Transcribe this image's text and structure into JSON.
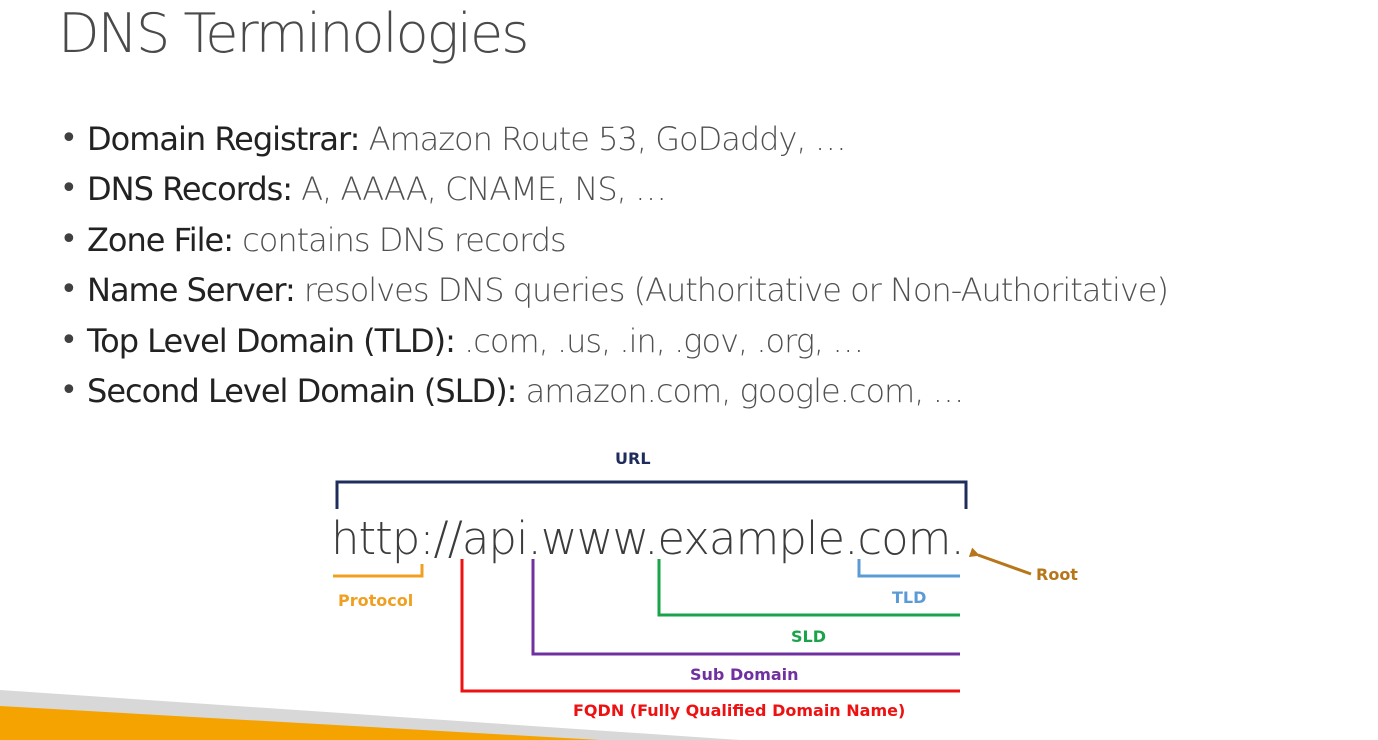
{
  "slide": {
    "title": "DNS Terminologies"
  },
  "bullets": [
    {
      "term": "Domain Registrar:",
      "desc": " Amazon Route 53, GoDaddy, …"
    },
    {
      "term": "DNS Records:",
      "desc": " A, AAAA, CNAME, NS, …"
    },
    {
      "term": "Zone File:",
      "desc": " contains DNS records"
    },
    {
      "term": "Name Server:",
      "desc": " resolves DNS queries (Authoritative or Non-Authoritative)"
    },
    {
      "term": "Top Level Domain (TLD):",
      "desc": " .com, .us, .in, .gov, .org, …"
    },
    {
      "term": "Second Level Domain (SLD):",
      "desc": " amazon.com, google.com, …"
    }
  ],
  "bullet_symbol": "•",
  "diagram": {
    "url_text": "http://api.www.example.com.",
    "labels": {
      "url": "URL",
      "protocol": "Protocol",
      "tld": "TLD",
      "root": "Root",
      "sld": "SLD",
      "sub_domain": "Sub Domain",
      "fqdn": "FQDN (Fully Qualified Domain Name)"
    },
    "colors": {
      "url": "#1f2d5c",
      "protocol": "#f0a020",
      "tld": "#5b9bd5",
      "root": "#b8761a",
      "sld": "#1aa34a",
      "sub_domain": "#7030a0",
      "fqdn": "#ee1111",
      "footer_orange": "#f5a300",
      "footer_gray": "#d8d8d8"
    }
  }
}
